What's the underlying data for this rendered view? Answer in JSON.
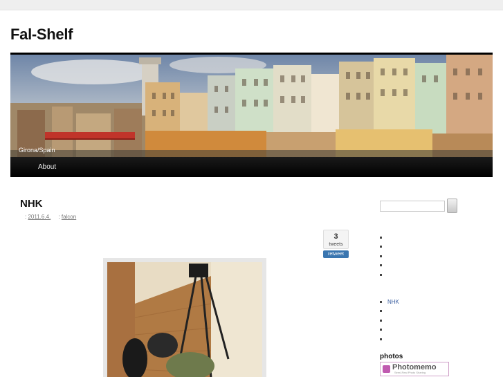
{
  "site": {
    "title": "Fal-Shelf"
  },
  "header": {
    "image_caption": "Girona/Spain"
  },
  "nav": {
    "items": [
      {
        "label": "About"
      }
    ]
  },
  "post": {
    "title": "NHK",
    "date_prefix": ":",
    "date": "2011.6.4.",
    "author_prefix": ":",
    "author": "falcon"
  },
  "tweet_widget": {
    "count": "3",
    "word": "tweets",
    "button": "retweet"
  },
  "sidebar": {
    "list1_count": 5,
    "list2": [
      {
        "label": "NHK"
      },
      {
        "label": ""
      },
      {
        "label": ""
      },
      {
        "label": ""
      },
      {
        "label": ""
      }
    ],
    "photos_title": "photos",
    "photomemo_label": "Photomemo",
    "photomemo_sub": "Semi-Real Photo Sharing"
  },
  "colors": {
    "link": "#3b5fa0",
    "nav_bg": "#000000",
    "retweet": "#3a76b0"
  }
}
